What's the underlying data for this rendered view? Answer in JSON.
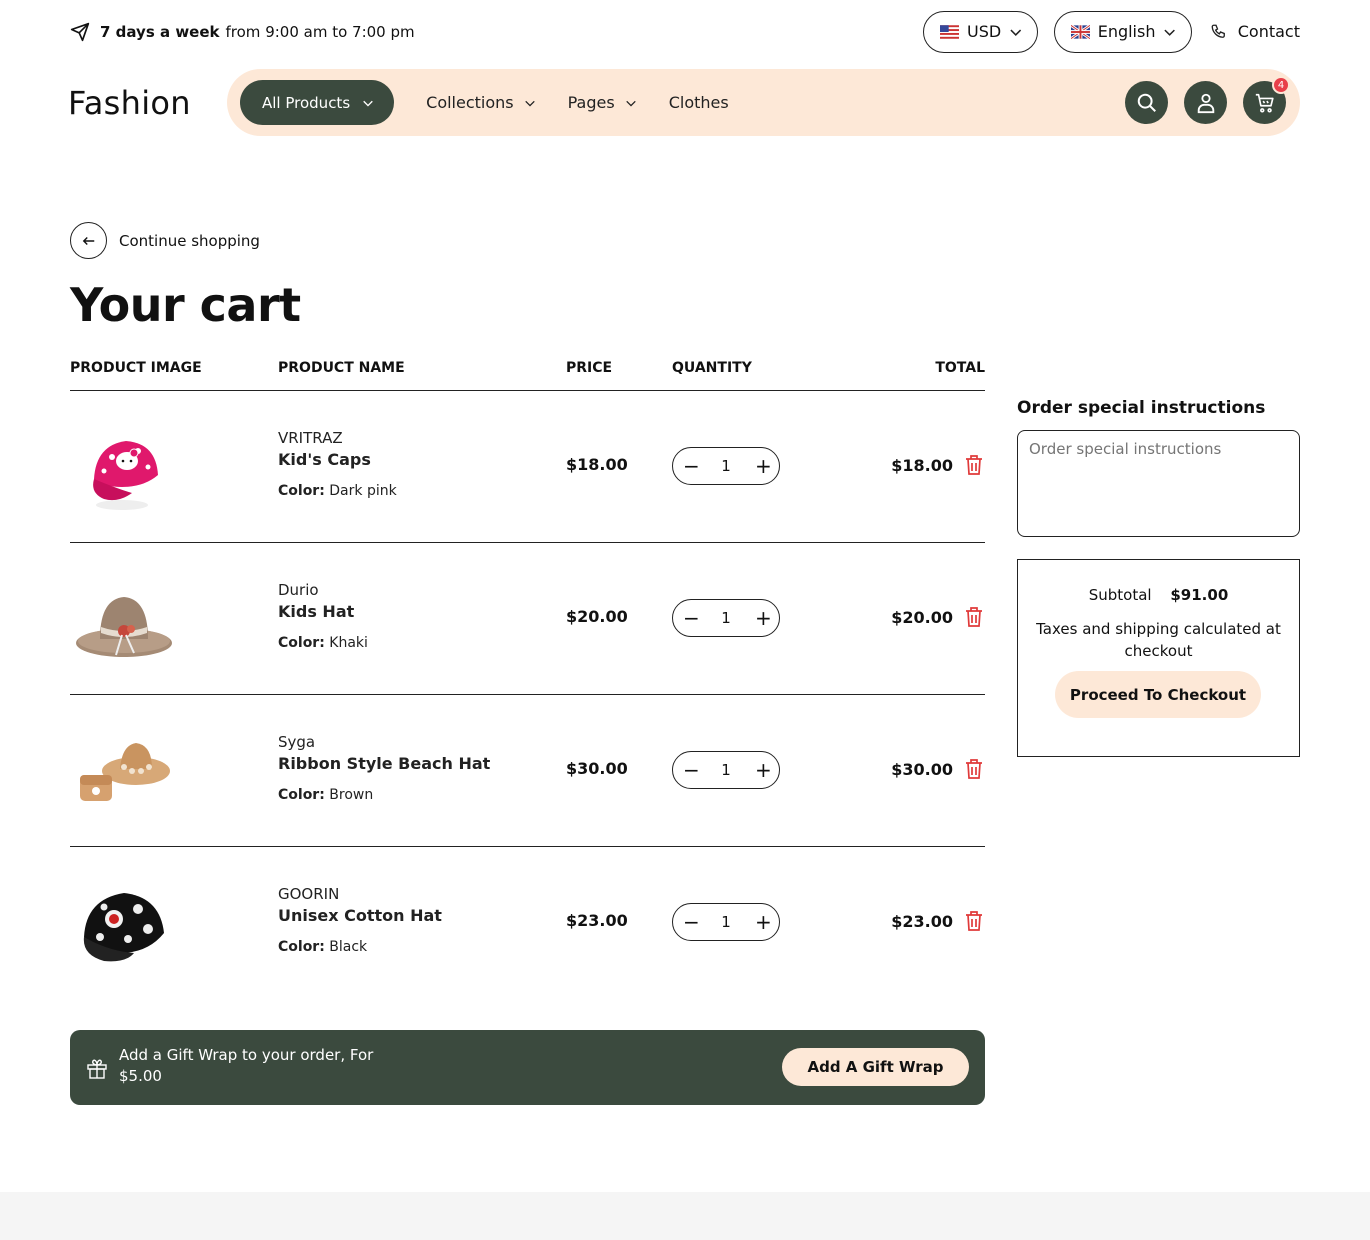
{
  "topbar": {
    "days_bold": "7 days a week",
    "hours_text": "from 9:00 am to 7:00 pm",
    "currency": "USD",
    "language": "English",
    "contact": "Contact"
  },
  "header": {
    "logo": "Fashion",
    "nav": {
      "all_products": "All Products",
      "collections": "Collections",
      "pages": "Pages",
      "clothes": "Clothes"
    },
    "cart_count": "4"
  },
  "page": {
    "continue_shopping": "Continue shopping",
    "title": "Your cart"
  },
  "table": {
    "headers": {
      "image": "PRODUCT IMAGE",
      "name": "PRODUCT NAME",
      "price": "PRICE",
      "quantity": "QUANTITY",
      "total": "TOTAL"
    },
    "color_label": "Color:",
    "items": [
      {
        "vendor": "VRITRAZ",
        "name": "Kid's Caps",
        "color": "Dark pink",
        "price": "$18.00",
        "qty": "1",
        "total": "$18.00"
      },
      {
        "vendor": "Durio",
        "name": "Kids Hat",
        "color": "Khaki",
        "price": "$20.00",
        "qty": "1",
        "total": "$20.00"
      },
      {
        "vendor": "Syga",
        "name": "Ribbon Style Beach Hat",
        "color": "Brown",
        "price": "$30.00",
        "qty": "1",
        "total": "$30.00"
      },
      {
        "vendor": "GOORIN",
        "name": "Unisex Cotton Hat",
        "color": "Black",
        "price": "$23.00",
        "qty": "1",
        "total": "$23.00"
      }
    ]
  },
  "gift": {
    "text": "Add a Gift Wrap to your order, For $5.00",
    "button": "Add A Gift Wrap"
  },
  "sidebar": {
    "instructions_label": "Order special instructions",
    "instructions_placeholder": "Order special instructions",
    "subtotal_label": "Subtotal",
    "subtotal_value": "$91.00",
    "tax_note": "Taxes and shipping calculated at checkout",
    "checkout_button": "Proceed To Checkout"
  },
  "colors": {
    "accent_dark": "#3b4a3e",
    "accent_light": "#fde8d7",
    "badge": "#e8404a",
    "trash": "#e03a3a"
  },
  "icons": [
    "send-icon",
    "chevron-down-icon",
    "us-flag-icon",
    "uk-flag-icon",
    "phone-icon",
    "search-icon",
    "user-icon",
    "cart-icon",
    "arrow-left-icon",
    "minus-icon",
    "plus-icon",
    "trash-icon",
    "gift-icon"
  ]
}
